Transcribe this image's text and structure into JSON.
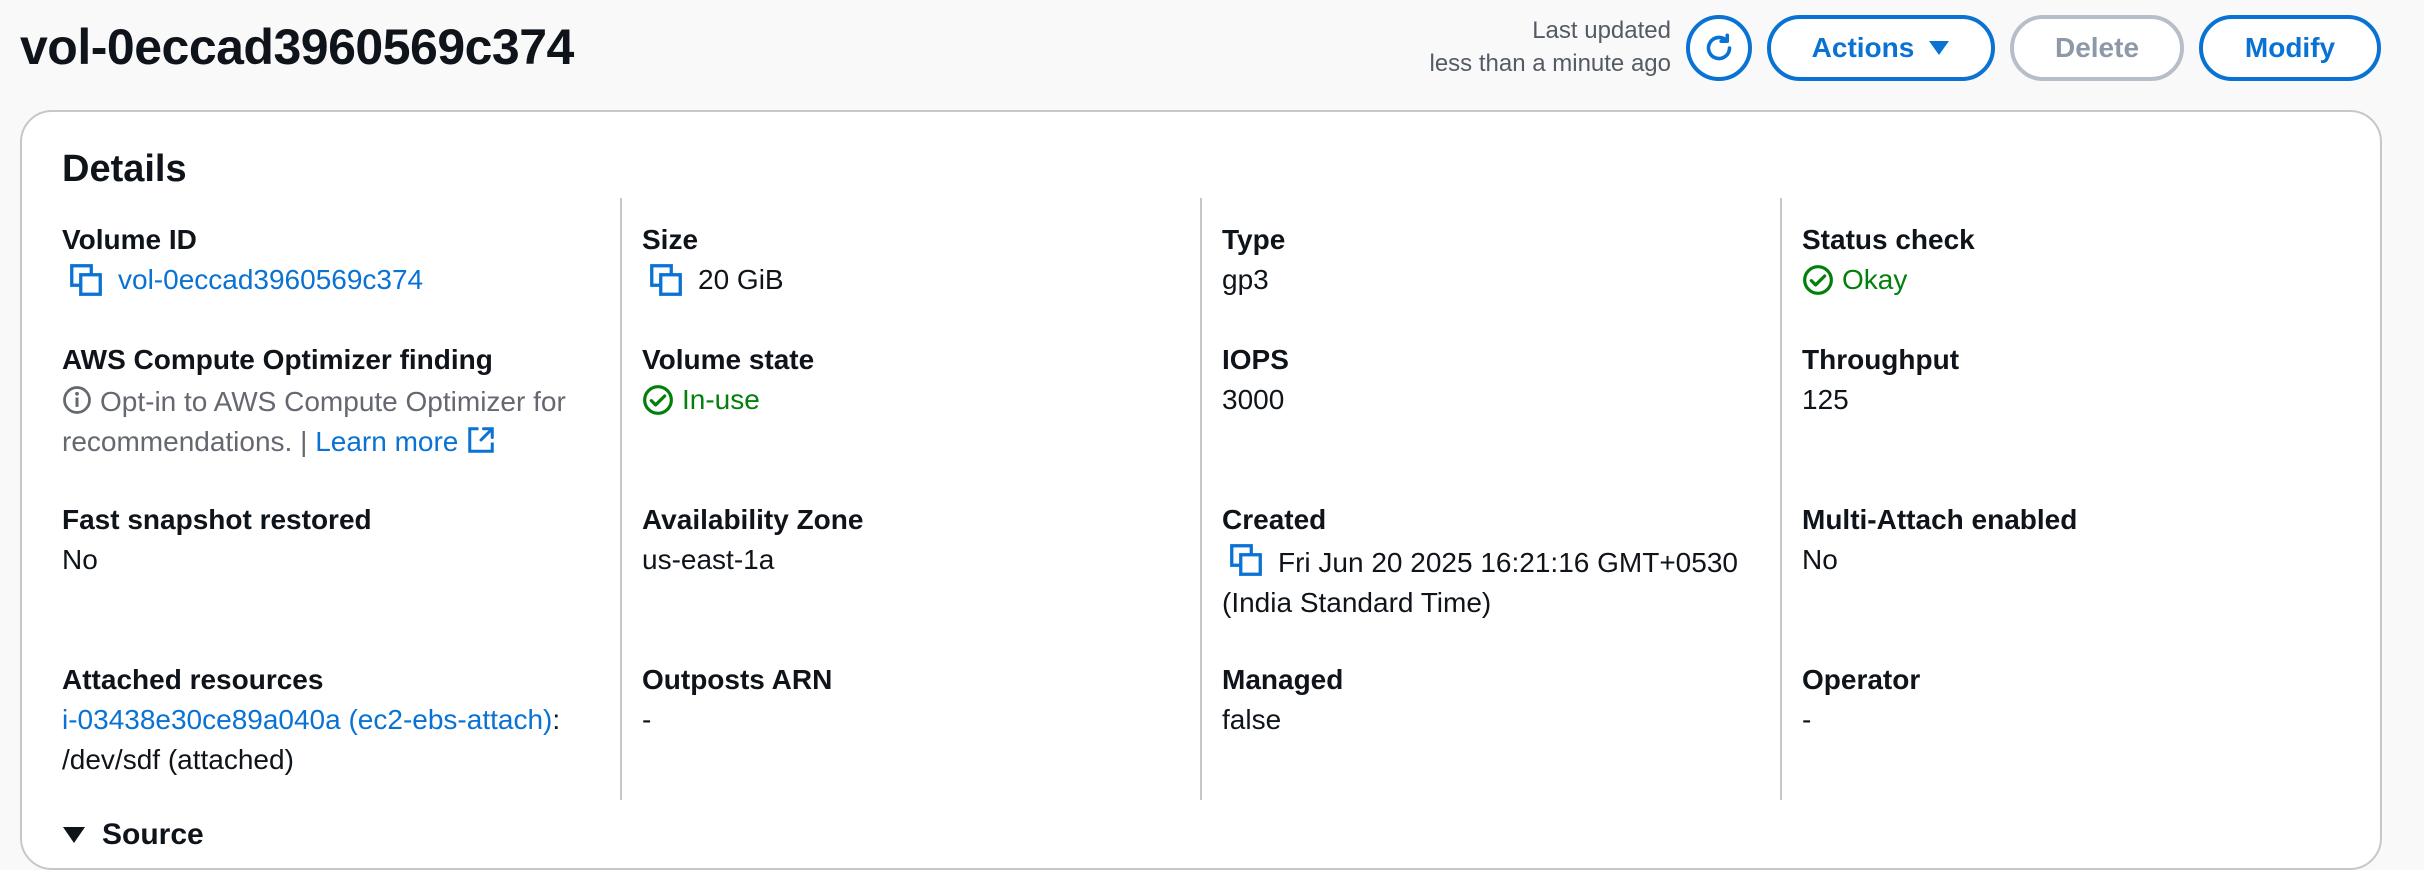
{
  "header": {
    "title": "vol-0eccad3960569c374",
    "last_updated_label": "Last updated",
    "last_updated_value": "less than a minute ago",
    "refresh_icon": "refresh-icon",
    "actions_label": "Actions",
    "delete_label": "Delete",
    "modify_label": "Modify"
  },
  "details": {
    "title": "Details",
    "volume_id": {
      "label": "Volume ID",
      "value": "vol-0eccad3960569c374"
    },
    "size": {
      "label": "Size",
      "value": "20 GiB"
    },
    "type": {
      "label": "Type",
      "value": "gp3"
    },
    "status_check": {
      "label": "Status check",
      "value": "Okay"
    },
    "compute_optimizer": {
      "label": "AWS Compute Optimizer finding",
      "text": "Opt-in to AWS Compute Optimizer for recommendations.",
      "separator": "|",
      "link": "Learn more"
    },
    "volume_state": {
      "label": "Volume state",
      "value": "In-use"
    },
    "iops": {
      "label": "IOPS",
      "value": "3000"
    },
    "throughput": {
      "label": "Throughput",
      "value": "125"
    },
    "fast_snapshot": {
      "label": "Fast snapshot restored",
      "value": "No"
    },
    "availability_zone": {
      "label": "Availability Zone",
      "value": "us-east-1a"
    },
    "created": {
      "label": "Created",
      "value": "Fri Jun 20 2025 16:21:16 GMT+0530 (India Standard Time)"
    },
    "multi_attach": {
      "label": "Multi-Attach enabled",
      "value": "No"
    },
    "attached_resources": {
      "label": "Attached resources",
      "link": "i-03438e30ce89a040a (ec2-ebs-attach)",
      "suffix": ": /dev/sdf (attached)"
    },
    "outposts_arn": {
      "label": "Outposts ARN",
      "value": "-"
    },
    "managed": {
      "label": "Managed",
      "value": "false"
    },
    "operator": {
      "label": "Operator",
      "value": "-"
    }
  },
  "source": {
    "label": "Source"
  },
  "colors": {
    "link": "#0972d3",
    "success": "#037f0c",
    "border": "#c6c6cd"
  }
}
